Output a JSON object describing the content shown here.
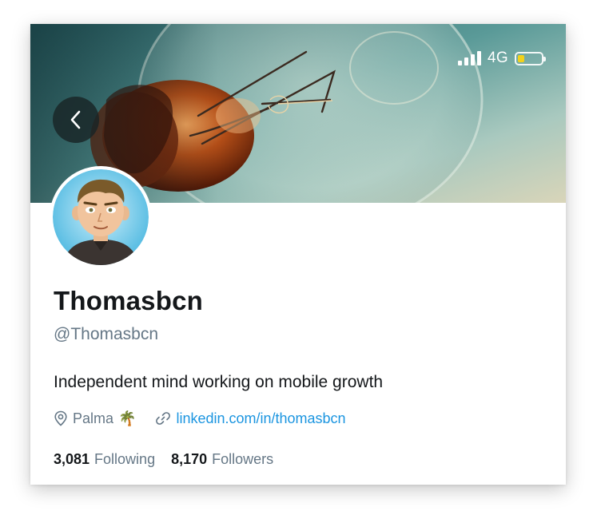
{
  "status_bar": {
    "network": "4G",
    "battery_level": 0.3,
    "battery_color": "#f2d21b",
    "signal_icon": "signal-bars-icon"
  },
  "header": {
    "back_icon": "chevron-left-icon"
  },
  "profile": {
    "display_name": "Thomasbcn",
    "handle": "@Thomasbcn",
    "bio": "Independent mind working on mobile growth",
    "location": "Palma",
    "location_emoji": "🌴",
    "location_icon": "location-pin-icon",
    "link_icon": "link-icon",
    "website": "linkedin.com/in/thomasbcn"
  },
  "stats": {
    "following_count": "3,081",
    "following_label": "Following",
    "followers_count": "8,170",
    "followers_label": "Followers"
  },
  "colors": {
    "link": "#1b95e0",
    "secondary_text": "#657786",
    "primary_text": "#14171a"
  }
}
